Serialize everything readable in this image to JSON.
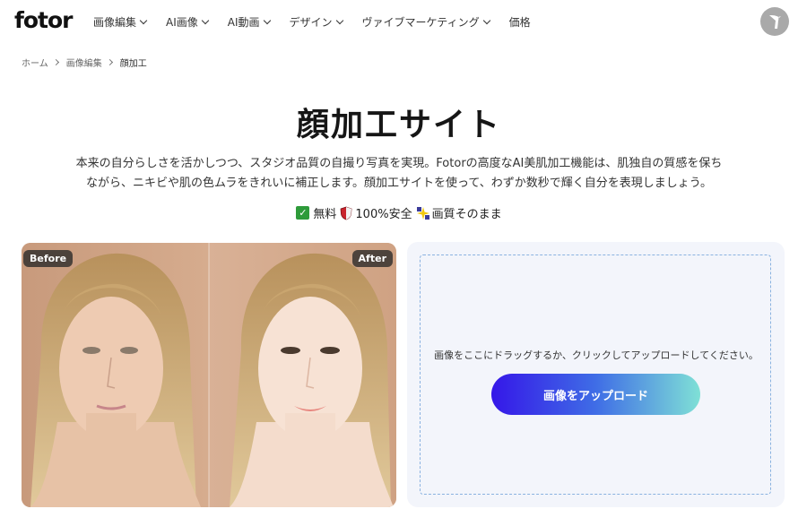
{
  "header": {
    "logo": "fotor",
    "nav": [
      {
        "label": "画像編集",
        "icon": "chevron-down-icon"
      },
      {
        "label": "AI画像",
        "icon": "chevron-down-icon"
      },
      {
        "label": "AI動画",
        "icon": "chevron-down-icon"
      },
      {
        "label": "デザイン",
        "icon": "chevron-down-icon"
      },
      {
        "label": "ヴァイブマーケティング",
        "icon": "chevron-down-icon"
      },
      {
        "label": "価格"
      }
    ],
    "avatar_icon": "bird-icon"
  },
  "breadcrumb": [
    "ホーム",
    "画像編集",
    "顔加工"
  ],
  "hero": {
    "title": "顔加工サイト",
    "description_line1": "本来の自分らしさを活かしつつ、スタジオ品質の自撮り写真を実現。Fotorの高度なAI美肌加工機能は、肌独自の質感を保ち",
    "description_line2": "ながら、ニキビや肌の色ムラをきれいに補正します。顔加工サイトを使って、わずか数秒で輝く自分を表現しましょう。",
    "features": [
      {
        "label": "無料",
        "icon": "check-icon"
      },
      {
        "label": "100%安全",
        "icon": "shield-icon"
      },
      {
        "label": "画質そのまま",
        "icon": "sparkle-icon"
      }
    ]
  },
  "comparison": {
    "before_label": "Before",
    "after_label": "After"
  },
  "upload": {
    "drop_text": "画像をここにドラッグするか、クリックしてアップロードしてください。",
    "button_label": "画像をアップロード"
  },
  "colors": {
    "accent_gradient_start": "#3517e8",
    "accent_gradient_end": "#7fe0d6",
    "panel_bg": "#f3f5fb",
    "dashed_border": "#8ab2e0"
  }
}
